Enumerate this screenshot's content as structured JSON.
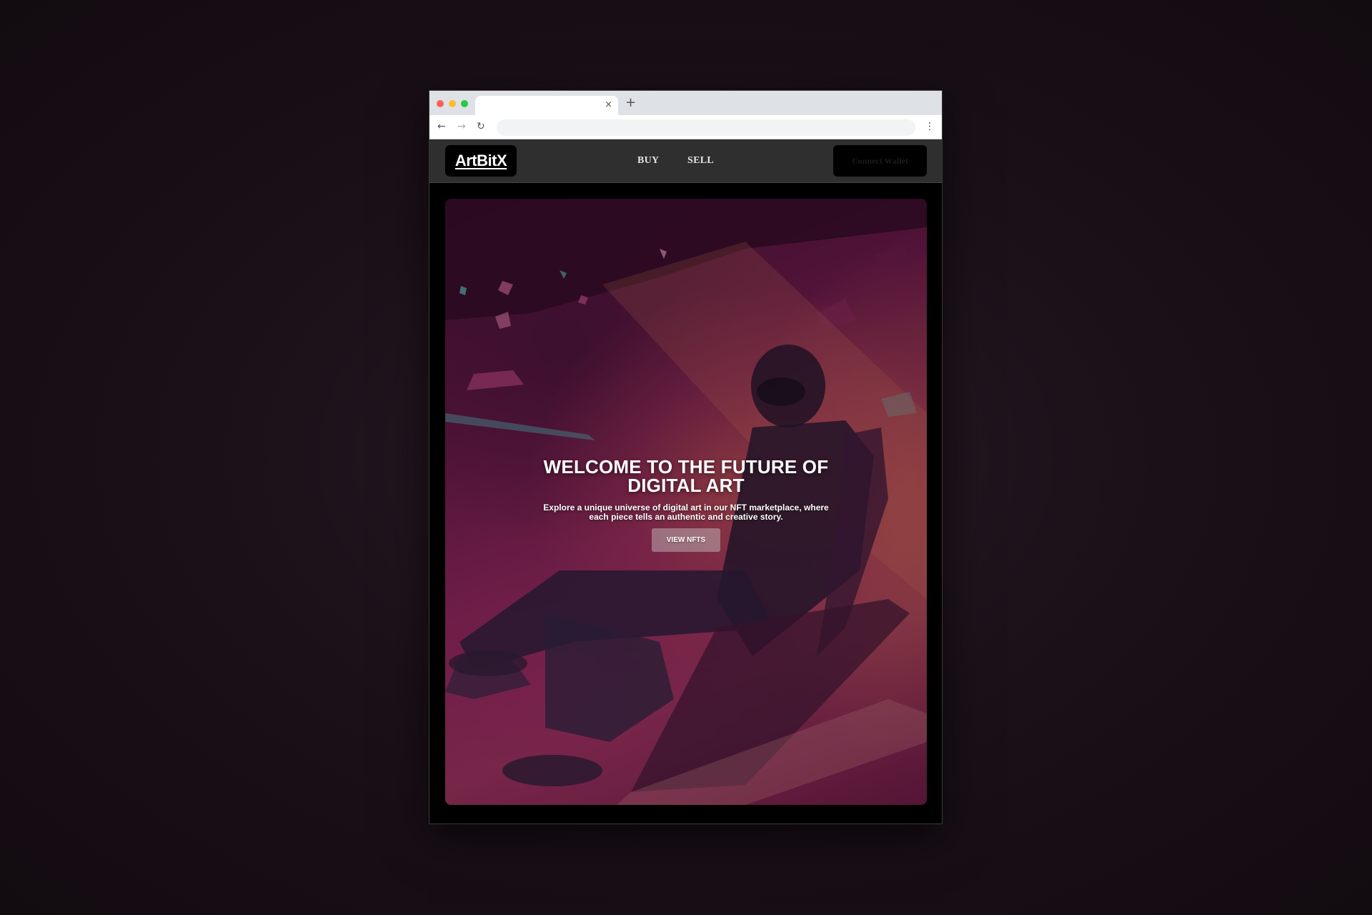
{
  "browser": {
    "tab": {
      "title": "",
      "close_glyph": "×"
    },
    "new_tab_glyph": "+",
    "nav": {
      "back_glyph": "←",
      "forward_glyph": "→",
      "reload_glyph": "↻",
      "menu_glyph": "⋮"
    },
    "address": {
      "value": ""
    }
  },
  "site": {
    "logo_text": "ArtBitX",
    "nav": {
      "buy_label": "BUY",
      "sell_label": "SELL"
    },
    "connect_button_label": "Connect Wallet"
  },
  "hero": {
    "title": "WELCOME TO THE FUTURE OF DIGITAL ART",
    "subtitle": "Explore a unique universe of digital art in our NFT marketplace, where each piece tells an authentic and creative story.",
    "cta_label": "VIEW NFTS"
  },
  "colors": {
    "page_background": "#1b1119",
    "header_background": "#2f2f2f",
    "logo_background": "#000000",
    "hero_accent": "#8e2a5a"
  }
}
